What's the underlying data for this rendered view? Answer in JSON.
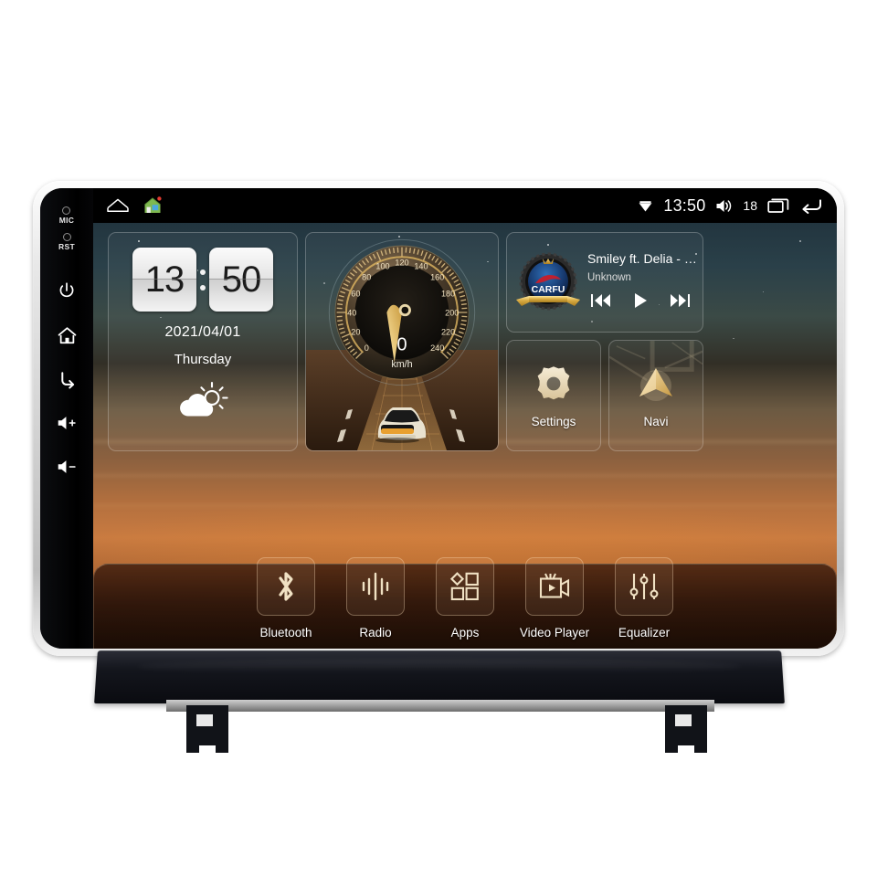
{
  "device": {
    "name": "car-head-unit",
    "hardware_buttons": [
      {
        "id": "mic",
        "label": "MIC",
        "icon": "microphone-pinhole"
      },
      {
        "id": "rst",
        "label": "RST",
        "icon": "reset-pinhole"
      },
      {
        "id": "power",
        "label": "",
        "icon": "power-icon"
      },
      {
        "id": "home",
        "label": "",
        "icon": "home-icon"
      },
      {
        "id": "back",
        "label": "",
        "icon": "back-icon"
      },
      {
        "id": "volume-up",
        "label": "+",
        "icon": "volume-up-icon"
      },
      {
        "id": "volume-down",
        "label": "-",
        "icon": "volume-down-icon"
      }
    ]
  },
  "statusbar": {
    "home_icon": "home-outline-icon",
    "launcher_icon": "house-app-icon",
    "signal_icon": "signal-diamond-icon",
    "time": "13:50",
    "volume_icon": "volume-icon",
    "volume_level": "18",
    "recents_icon": "recent-apps-icon",
    "back_icon": "back-arrow-icon"
  },
  "clock_widget": {
    "hours": "13",
    "minutes": "50",
    "date": "2021/04/01",
    "weekday": "Thursday",
    "weather_icon": "partly-cloudy-icon"
  },
  "speedometer_widget": {
    "value": "0",
    "unit": "km/h",
    "ticks": [
      "0",
      "20",
      "40",
      "60",
      "80",
      "100",
      "120",
      "140",
      "160",
      "180",
      "200",
      "220",
      "240"
    ],
    "min": 0,
    "max": 240,
    "dial_color": "#d8a850",
    "car_graphic": "car-on-road-icon"
  },
  "music_widget": {
    "album_art": "carfu-badge-logo",
    "brand": "CARFU",
    "track": "Smiley ft. Delia - Ne v...",
    "artist": "Unknown",
    "prev_icon": "skip-previous-icon",
    "play_icon": "play-icon",
    "next_icon": "skip-next-icon"
  },
  "tiles": [
    {
      "id": "settings",
      "label": "Settings",
      "icon": "gear-icon"
    },
    {
      "id": "navi",
      "label": "Navi",
      "icon": "navigation-arrow-icon"
    }
  ],
  "dock_apps": [
    {
      "id": "bluetooth",
      "label": "Bluetooth",
      "icon": "bluetooth-icon"
    },
    {
      "id": "radio",
      "label": "Radio",
      "icon": "radio-waveform-icon"
    },
    {
      "id": "apps",
      "label": "Apps",
      "icon": "apps-grid-icon"
    },
    {
      "id": "video-player",
      "label": "Video Player",
      "icon": "video-camera-icon"
    },
    {
      "id": "equalizer",
      "label": "Equalizer",
      "icon": "equalizer-sliders-icon"
    }
  ],
  "colors": {
    "accent_gold": "#d8a850",
    "bezel_silver": "#d3d3d3",
    "screen_black": "#000000",
    "brand_blue": "#1b3c78",
    "brand_red": "#b41f2b"
  }
}
